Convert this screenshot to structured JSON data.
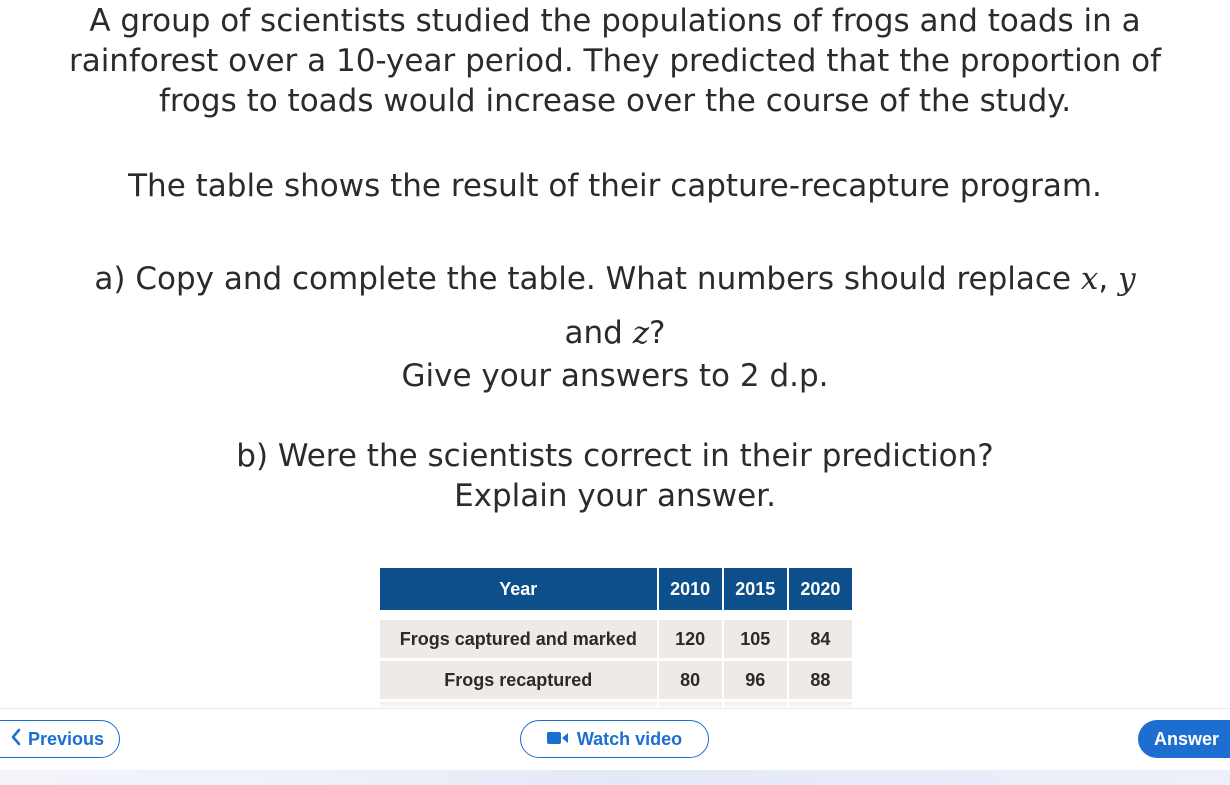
{
  "question": {
    "intro_1": "A group of scientists studied the populations of frogs and toads in a",
    "intro_2": "rainforest over a 10-year period. They predicted that the proportion of",
    "intro_3": "frogs to toads would increase over the course of the study.",
    "table_intro": "The table shows the result of their capture-recapture program.",
    "a_text": "a) Copy and complete the table. What numbers should replace",
    "a_var_x": "x",
    "a_sep": ", ",
    "a_var_y": "y",
    "a_and": "and",
    "a_var_z": "z",
    "a_q": "?",
    "a_dp": "Give your answers to 2 d.p.",
    "b_text": "b) Were the scientists correct in their prediction?",
    "b_explain": "Explain your answer."
  },
  "table": {
    "headers": [
      "Year",
      "2010",
      "2015",
      "2020"
    ],
    "rows": [
      {
        "label": "Frogs captured and marked",
        "values": [
          "120",
          "105",
          "84"
        ]
      },
      {
        "label": "Frogs recaptured",
        "values": [
          "80",
          "96",
          "88"
        ]
      }
    ]
  },
  "nav": {
    "previous_label": "Previous",
    "video_label": "Watch video",
    "answer_label": "Answer",
    "accent_color": "#1c6fd0",
    "header_color": "#0c4f8a",
    "icons": [
      "chevron-left-icon",
      "video-camera-icon"
    ]
  }
}
